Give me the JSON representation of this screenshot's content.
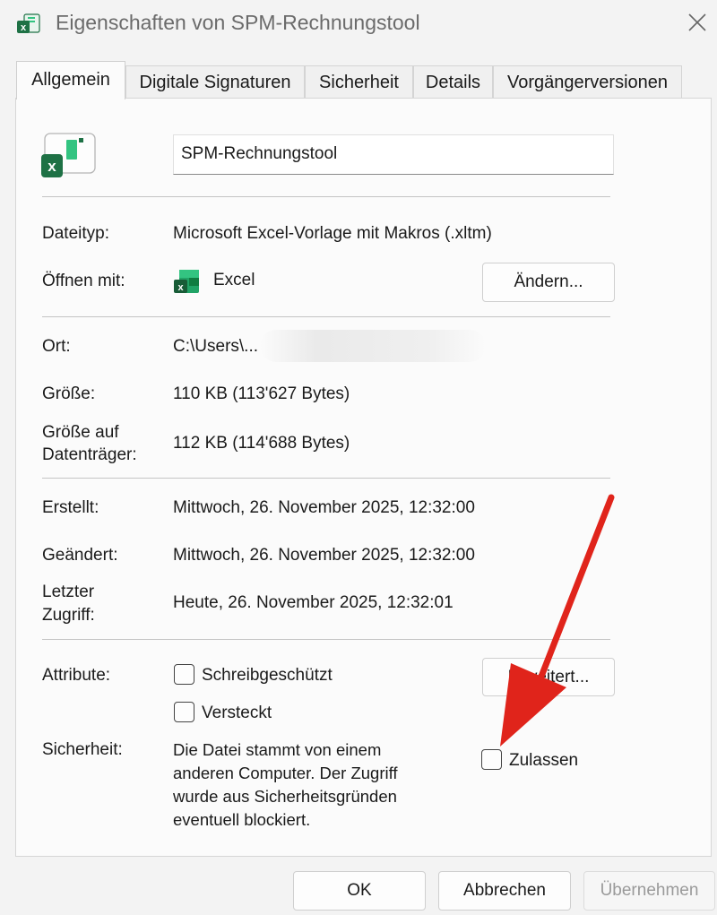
{
  "window": {
    "title": "Eigenschaften von SPM-Rechnungstool"
  },
  "tabs": [
    {
      "label": "Allgemein",
      "active": true
    },
    {
      "label": "Digitale Signaturen",
      "active": false
    },
    {
      "label": "Sicherheit",
      "active": false
    },
    {
      "label": "Details",
      "active": false
    },
    {
      "label": "Vorgängerversionen",
      "active": false
    }
  ],
  "file": {
    "name": "SPM-Rechnungstool",
    "icon": "excel-template-icon"
  },
  "fields": {
    "dateityp": {
      "label": "Dateityp:",
      "value": "Microsoft Excel-Vorlage mit Makros (.xltm)"
    },
    "oeffnen": {
      "label": "Öffnen mit:",
      "value": "Excel",
      "button": "Ändern..."
    },
    "ort": {
      "label": "Ort:",
      "value": "C:\\Users\\..."
    },
    "groesse": {
      "label": "Größe:",
      "value": "110 KB (113'627 Bytes)"
    },
    "groesse_disk": {
      "label_line1": "Größe auf",
      "label_line2": "Datenträger:",
      "value": "112 KB (114'688 Bytes)"
    },
    "erstellt": {
      "label": "Erstellt:",
      "value": "Mittwoch, 26. November 2025, 12:32:00"
    },
    "geaendert": {
      "label": "Geändert:",
      "value": "Mittwoch, 26. November 2025, 12:32:00"
    },
    "zugriff": {
      "label_line1": "Letzter",
      "label_line2": "Zugriff:",
      "value": "Heute, 26. November 2025, 12:32:01"
    }
  },
  "attributes": {
    "label": "Attribute:",
    "readonly": {
      "label": "Schreibgeschützt",
      "checked": false
    },
    "hidden": {
      "label": "Versteckt",
      "checked": false
    },
    "advanced_button": "Erweitert..."
  },
  "security": {
    "label": "Sicherheit:",
    "text_lines": [
      "Die Datei stammt von einem",
      "anderen Computer. Der Zugriff",
      "wurde aus Sicherheitsgründen",
      "eventuell blockiert."
    ],
    "allow": {
      "label": "Zulassen",
      "checked": false
    }
  },
  "footer": {
    "ok": "OK",
    "cancel": "Abbrechen",
    "apply": "Übernehmen"
  },
  "colors": {
    "excel_green": "#1e7145",
    "excel_light": "#33c481",
    "annotation_arrow": "#e0241b",
    "disabled_text": "#9a9a9a"
  }
}
